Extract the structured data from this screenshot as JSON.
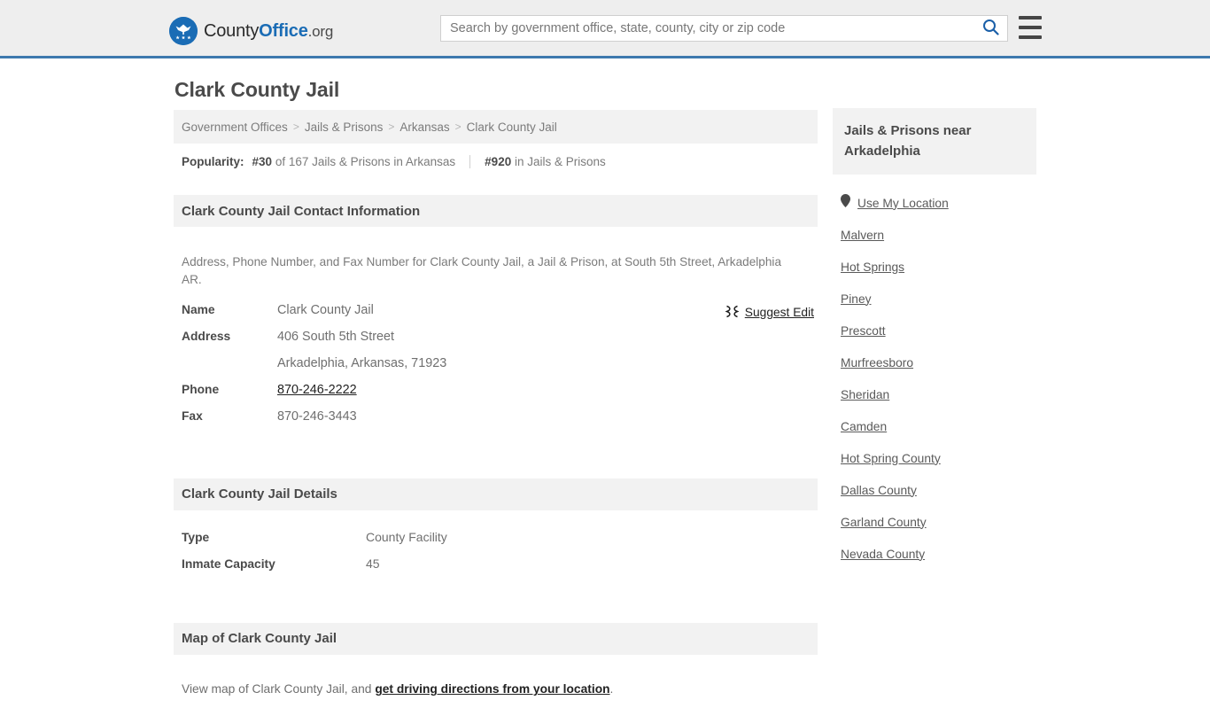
{
  "header": {
    "brand": {
      "icon": "eagle-seal-icon",
      "part1": "County",
      "part2": "Office",
      "part3": ".org"
    },
    "search": {
      "placeholder": "Search by government office, state, county, city or zip code",
      "value": "",
      "icon": "search-icon"
    },
    "menu_icon": "hamburger-menu-icon"
  },
  "page": {
    "title": "Clark County Jail"
  },
  "breadcrumb": {
    "separator": ">",
    "items": [
      {
        "label": "Government Offices"
      },
      {
        "label": "Jails & Prisons"
      },
      {
        "label": "Arkansas"
      },
      {
        "label": "Clark County Jail"
      }
    ]
  },
  "popularity": {
    "label": "Popularity:",
    "state_rank": "#30",
    "state_text": "of 167 Jails & Prisons in Arkansas",
    "national_rank": "#920",
    "national_text": "in Jails & Prisons"
  },
  "contact": {
    "heading": "Clark County Jail Contact Information",
    "description": "Address, Phone Number, and Fax Number for Clark County Jail, a Jail & Prison, at South 5th Street, Arkadelphia AR.",
    "suggest_edit": {
      "label": "Suggest Edit",
      "icon": "suggest-edit-icon"
    },
    "rows": [
      {
        "key": "Name",
        "value": "Clark County Jail",
        "link": false,
        "indent": false
      },
      {
        "key": "Address",
        "value": "406 South 5th Street",
        "link": false,
        "indent": false
      },
      {
        "key": "",
        "value": "Arkadelphia, Arkansas, 71923",
        "link": false,
        "indent": true
      },
      {
        "key": "Phone",
        "value": "870-246-2222",
        "link": true,
        "indent": false
      },
      {
        "key": "Fax",
        "value": "870-246-3443",
        "link": false,
        "indent": false
      }
    ]
  },
  "details": {
    "heading": "Clark County Jail Details",
    "rows": [
      {
        "key": "Type",
        "value": "County Facility"
      },
      {
        "key": "Inmate Capacity",
        "value": "45"
      }
    ]
  },
  "map": {
    "heading": "Map of Clark County Jail",
    "text_before": "View map of Clark County Jail, and ",
    "link_label": "get driving directions from your location",
    "text_after": "."
  },
  "sidebar": {
    "heading": "Jails & Prisons near Arkadelphia",
    "use_my_location": {
      "label": "Use My Location",
      "icon": "map-pin-icon"
    },
    "items": [
      {
        "label": "Malvern"
      },
      {
        "label": "Hot Springs"
      },
      {
        "label": "Piney"
      },
      {
        "label": "Prescott"
      },
      {
        "label": "Murfreesboro"
      },
      {
        "label": "Sheridan"
      },
      {
        "label": "Camden"
      },
      {
        "label": "Hot Spring County"
      },
      {
        "label": "Dallas County"
      },
      {
        "label": "Garland County"
      },
      {
        "label": "Nevada County"
      }
    ]
  },
  "colors": {
    "header_bg": "#eeeeee",
    "header_border": "#3d79ae",
    "brand_blue": "#1a6cb5",
    "section_bg": "#f2f2f2",
    "text_dark": "#4a4a4a",
    "text_muted": "#7b7b7b"
  }
}
